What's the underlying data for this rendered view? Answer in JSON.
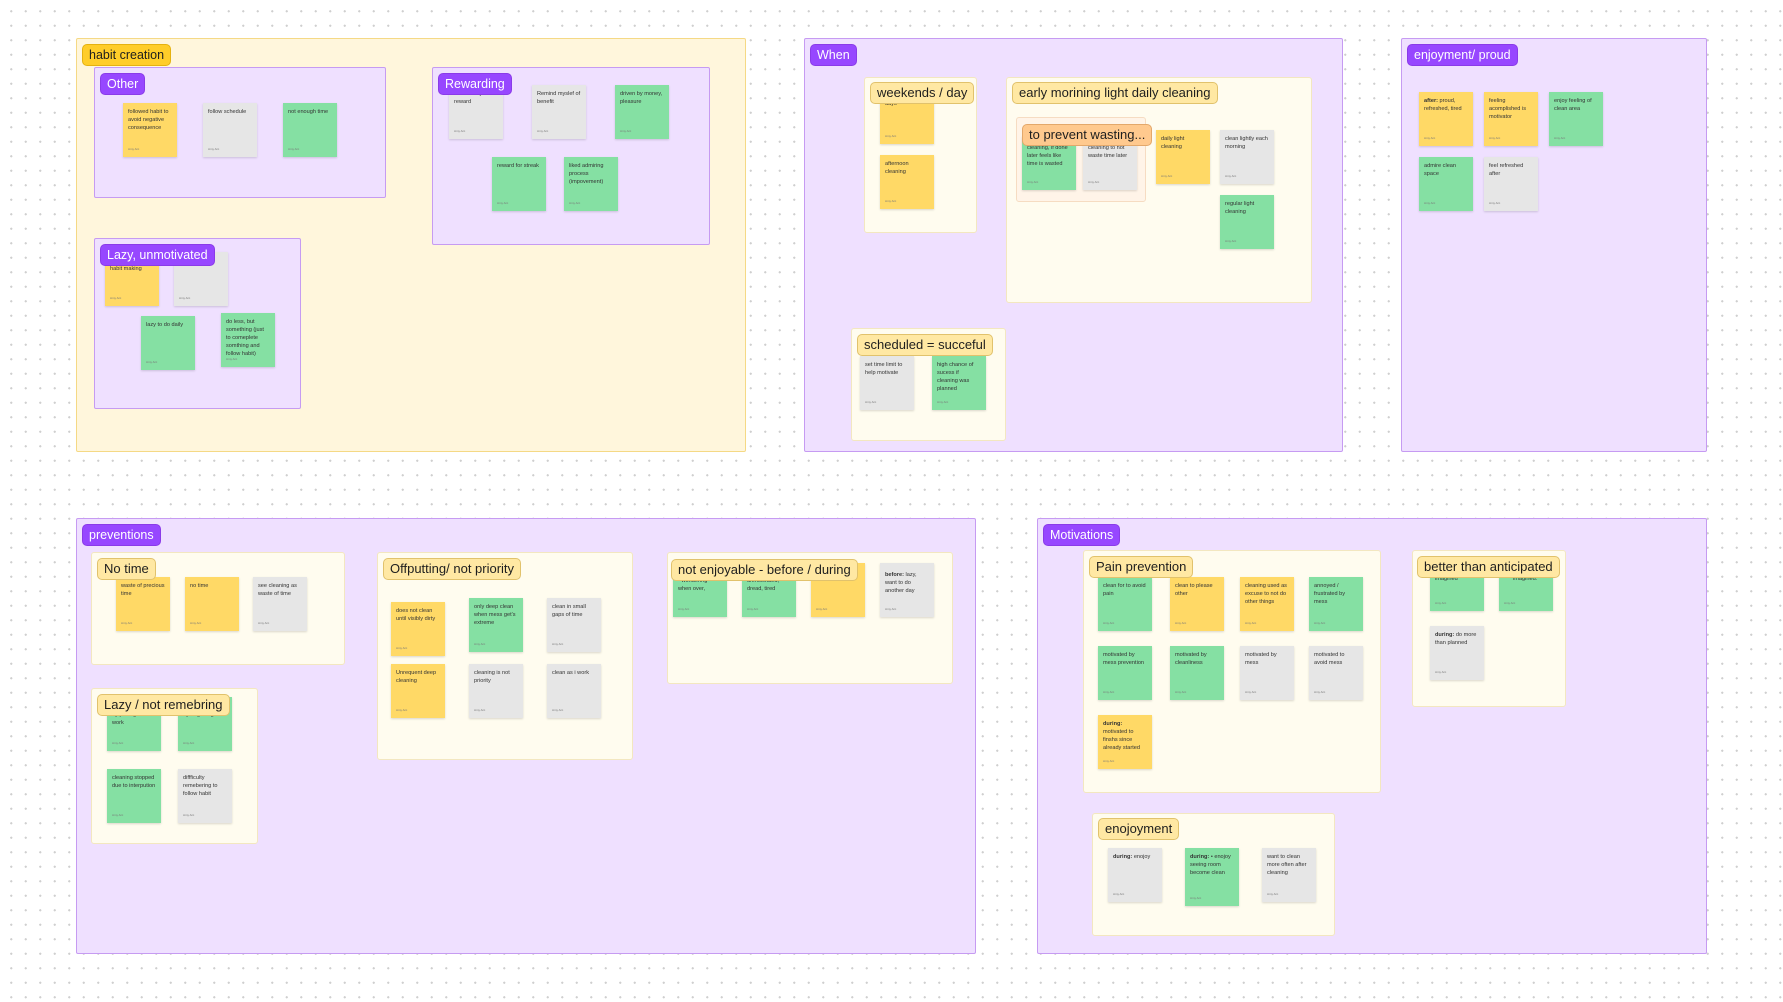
{
  "board": {
    "sections": {
      "habit_creation": {
        "title": "habit creation",
        "other": {
          "title": "Other",
          "stickies": [
            {
              "text": "followed habit to avoid negative consequence",
              "color": "yellow"
            },
            {
              "text": "follow schedule",
              "color": "gray"
            },
            {
              "text": "not enough time",
              "color": "green"
            }
          ]
        },
        "rewarding": {
          "title": "Rewarding",
          "stickies": [
            {
              "text": "Remind myslef of reward",
              "color": "gray"
            },
            {
              "text": "Remind myslef of benefit",
              "color": "gray"
            },
            {
              "text": "driven by money, pleasure",
              "color": "green"
            },
            {
              "text": "reward for streak",
              "color": "green"
            },
            {
              "text": "liked admiring process (impovement)",
              "color": "green"
            }
          ]
        },
        "lazy": {
          "title": "Lazy, unmotivated",
          "stickies": [
            {
              "text": "interfered with habit making",
              "color": "yellow"
            },
            {
              "text": "",
              "color": "gray"
            },
            {
              "text": "lazy to do daily",
              "color": "green"
            },
            {
              "text": "do less, but something (just to comeplete somthing and follow habit)",
              "color": "green"
            }
          ]
        }
      },
      "when": {
        "title": "When",
        "weekends": {
          "title": "weekends / day",
          "stickies": [
            {
              "text": "days",
              "color": "yellow"
            },
            {
              "text": "afternoon cleaning",
              "color": "yellow"
            }
          ]
        },
        "early": {
          "title": "early morining light daily cleaning",
          "prevent": {
            "title": "to prevent wasting...",
            "stickies": [
              {
                "text": "cleaning, if done later feels like time is wasted",
                "color": "green"
              },
              {
                "text": "cleaning to not waste time later",
                "color": "gray"
              }
            ]
          },
          "stickies": [
            {
              "text": "daily light cleaning",
              "color": "yellow"
            },
            {
              "text": "clean lightly each morning",
              "color": "gray"
            },
            {
              "text": "regular light cleaning",
              "color": "green"
            }
          ]
        },
        "scheduled": {
          "title": "scheduled = succeful",
          "stickies": [
            {
              "text": "set time limit to help motivate",
              "color": "gray"
            },
            {
              "text": "high chance of sucess if cleaning was planned",
              "color": "green"
            }
          ]
        }
      },
      "enjoyment_proud": {
        "title": "enjoyment/ proud",
        "stickies": [
          {
            "bold": "after:",
            "text": " proud, refreshed, tired",
            "color": "yellow"
          },
          {
            "text": "feeling acomplished is motivator",
            "color": "yellow"
          },
          {
            "text": "enjoy feeling of clean area",
            "color": "green"
          },
          {
            "text": "admire clean space",
            "color": "green"
          },
          {
            "text": "feel refreshed after",
            "color": "gray"
          }
        ]
      },
      "preventions": {
        "title": "preventions",
        "no_time": {
          "title": "No time",
          "stickies": [
            {
              "text": "waste of precious time",
              "color": "yellow"
            },
            {
              "text": "no time",
              "color": "yellow"
            },
            {
              "text": "see cleaning as waste of time",
              "color": "gray"
            }
          ]
        },
        "lazy": {
          "title": "Lazy / not remebring",
          "stickies": [
            {
              "text": "by putting off work",
              "color": "green"
            },
            {
              "text": "by forgetting",
              "color": "green"
            },
            {
              "text": "cleaning stopped due to interpution",
              "color": "green"
            },
            {
              "text": "diffficulty remebering to follow habit",
              "color": "gray"
            }
          ]
        },
        "offputting": {
          "title": "Offputting/ not priority",
          "stickies": [
            {
              "text": "does not clean until visibly dirty",
              "color": "yellow"
            },
            {
              "text": "only deep clean when mess get's extreme",
              "color": "green"
            },
            {
              "text": "clean in small gaps of time",
              "color": "gray"
            },
            {
              "text": "Unrequent deep cleaning",
              "color": "yellow"
            },
            {
              "text": "cleaning is not priority",
              "color": "gray"
            },
            {
              "text": "clean as i work",
              "color": "gray"
            }
          ]
        },
        "not_enjoyable": {
          "title": "not enjoyable - before / during",
          "stickies": [
            {
              "text": "• wondering when over,",
              "color": "green"
            },
            {
              "text": "unmotivated, dread, tired",
              "color": "green"
            },
            {
              "text": "red, not happy",
              "color": "yellow"
            },
            {
              "bold": "before:",
              "text": " lazy, want to do another day",
              "color": "gray"
            }
          ]
        }
      },
      "motivations": {
        "title": "Motivations",
        "pain": {
          "title": "Pain prevention",
          "stickies": [
            {
              "text": "clean for to avoid pain",
              "color": "green"
            },
            {
              "text": "clean to please other",
              "color": "yellow"
            },
            {
              "text": "cleaning used as excuse to not do other things",
              "color": "yellow"
            },
            {
              "text": "annoyed / frustrated by mess",
              "color": "green"
            },
            {
              "text": "motivated by mess prevention",
              "color": "green"
            },
            {
              "text": "motivated by cleanliness",
              "color": "green"
            },
            {
              "text": "motivated by mess",
              "color": "gray"
            },
            {
              "text": "motivated to avoid mess",
              "color": "gray"
            },
            {
              "bold": "during:",
              "text": " motivated to finshs since already started",
              "color": "yellow"
            }
          ]
        },
        "better": {
          "title": "better than anticipated",
          "stickies": [
            {
              "text": "imagined",
              "color": "green"
            },
            {
              "text": "imagined.",
              "color": "green"
            },
            {
              "bold": "during:",
              "text": " do more than planned",
              "color": "gray"
            }
          ]
        },
        "enjoyment": {
          "title": "enojoyment",
          "stickies": [
            {
              "bold": "during:",
              "text": " enojoy",
              "color": "gray"
            },
            {
              "bold": "during:",
              "text": " • enojoy seeing room become clean",
              "color": "green"
            },
            {
              "text": "want to clean more often after cleaning",
              "color": "gray"
            }
          ]
        }
      }
    },
    "sticky_author": "Amy Ant"
  }
}
